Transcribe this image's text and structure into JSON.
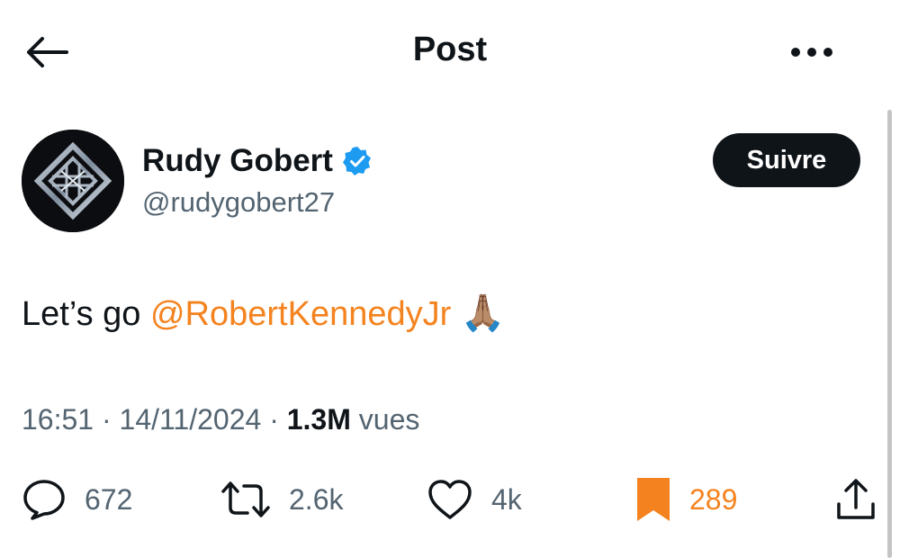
{
  "header": {
    "title": "Post",
    "back_icon": "arrow-left-icon",
    "more_icon": "more-dots-icon"
  },
  "author": {
    "name": "Rudy Gobert",
    "handle": "@rudygobert27",
    "verified_icon": "verified-badge-icon",
    "verified_color": "#1d9bf0",
    "follow_label": "Suivre"
  },
  "post": {
    "text_prefix": "Let’s go ",
    "mention": "@RobertKennedyJr",
    "emoji": "🙏🏽",
    "accent_color": "#f4831f",
    "time": "16:51",
    "date": "14/11/2024",
    "views_count": "1.3M",
    "views_label": "vues"
  },
  "actions": {
    "replies": "672",
    "reposts": "2.6k",
    "likes": "4k",
    "bookmarks": "289",
    "icons": [
      "reply-icon",
      "repost-icon",
      "like-icon",
      "bookmark-icon",
      "share-icon"
    ]
  }
}
